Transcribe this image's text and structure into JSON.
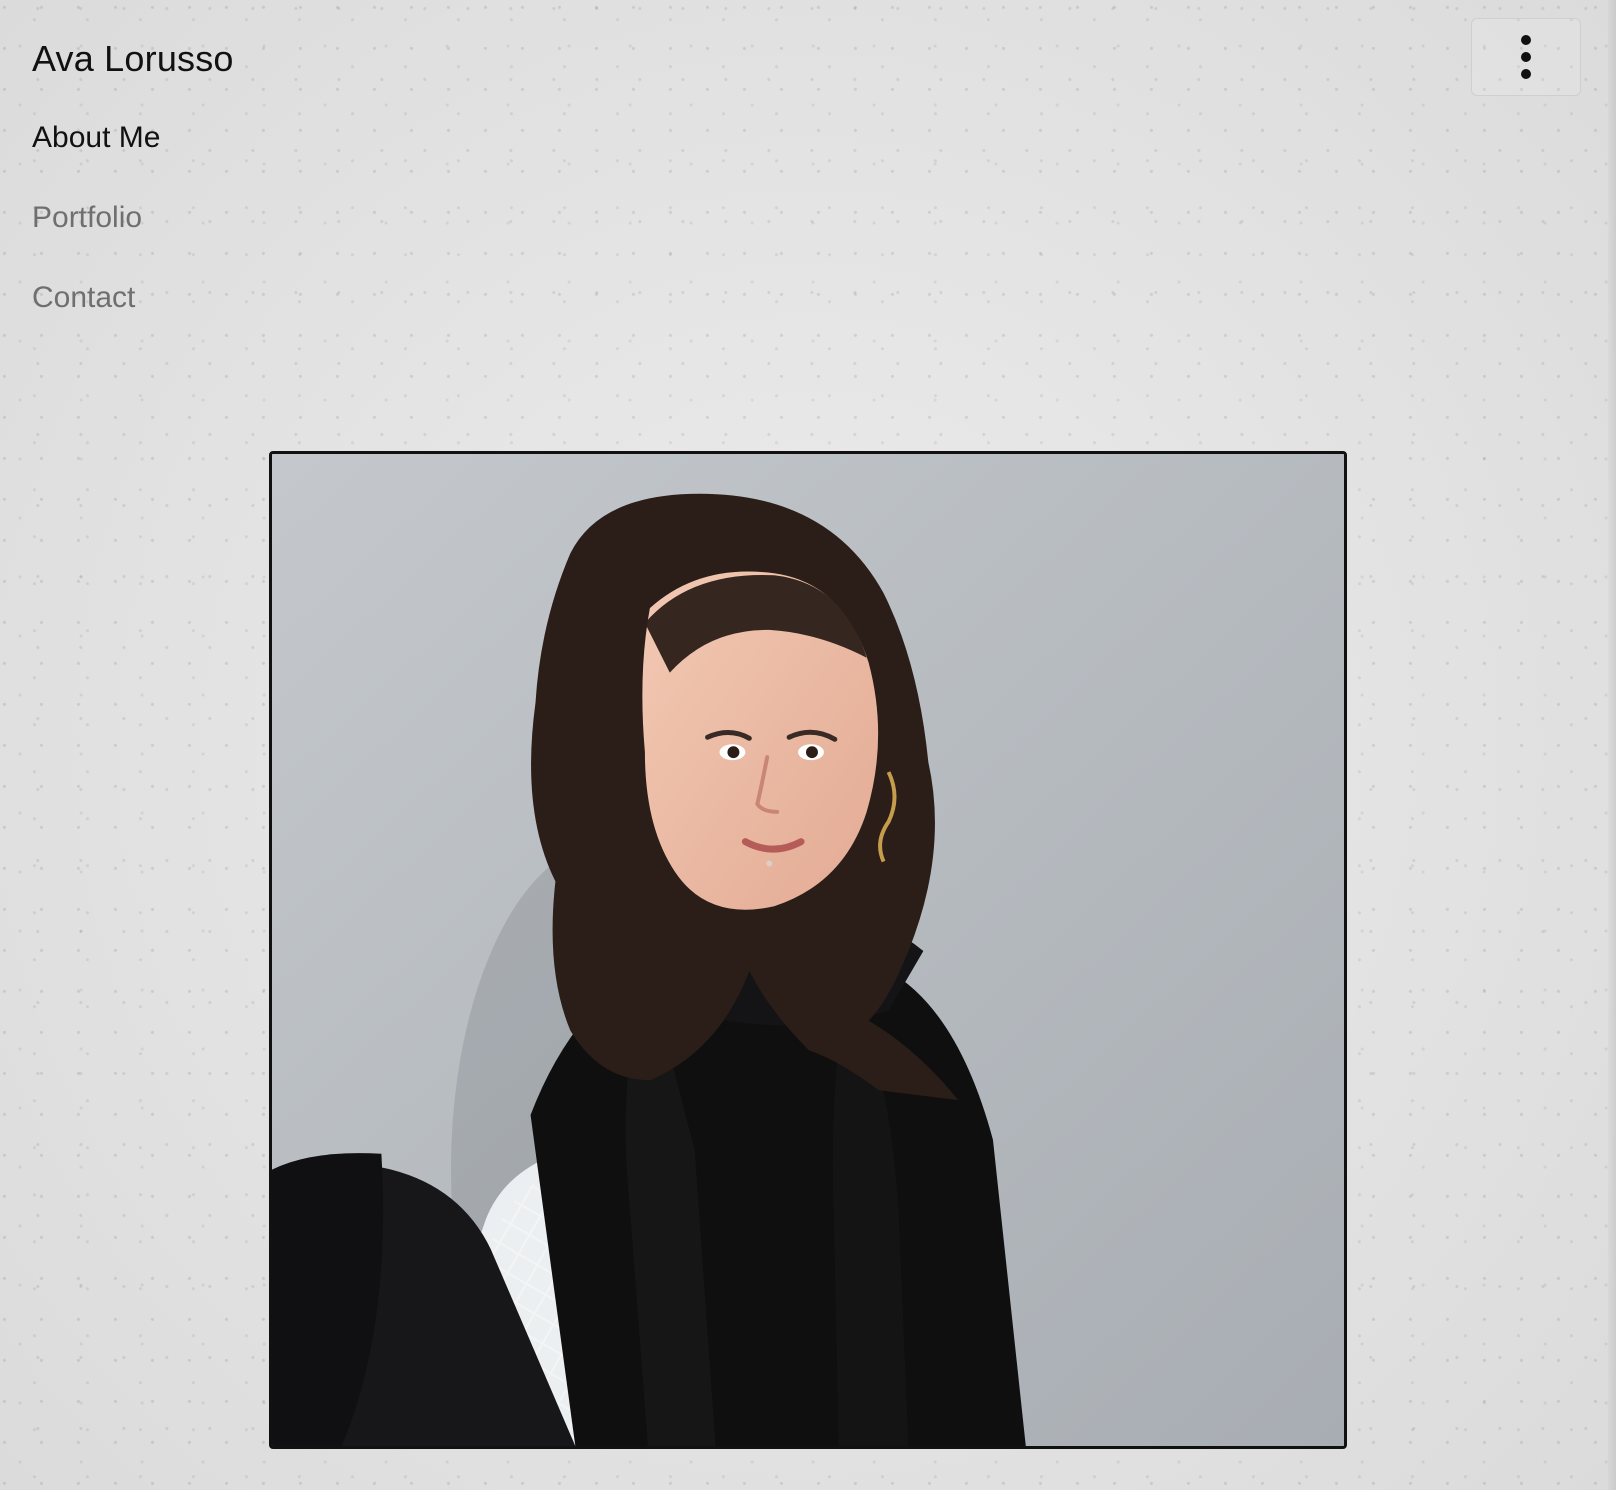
{
  "site": {
    "title": "Ava Lorusso"
  },
  "nav": {
    "items": [
      {
        "label": "About Me",
        "active": true
      },
      {
        "label": "Portfolio",
        "active": false
      },
      {
        "label": "Contact",
        "active": false
      }
    ]
  },
  "menu": {
    "icon": "more-vertical-icon"
  },
  "colors": {
    "background": "#e2e2e2",
    "text": "#111111",
    "nav_inactive": "#6f6f6f",
    "photo_border": "#111111",
    "photo_wall": "#b7bcc2"
  }
}
